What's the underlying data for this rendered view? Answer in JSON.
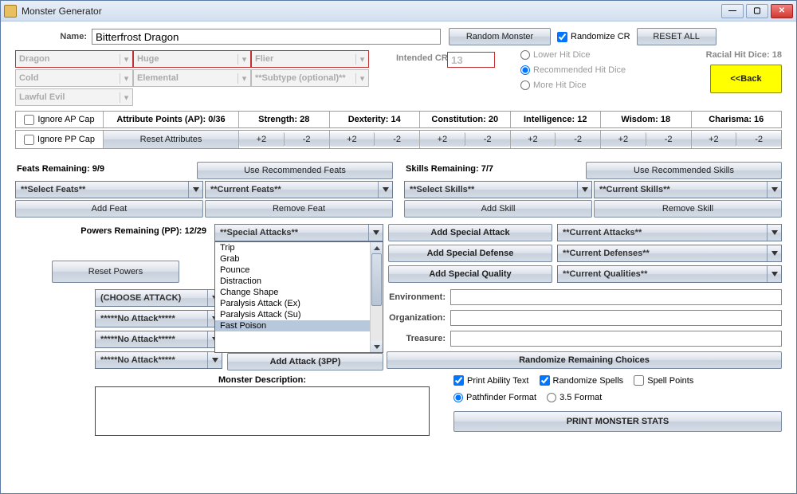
{
  "window_title": "Monster Generator",
  "name": {
    "label": "Name:",
    "value": "Bitterfrost Dragon"
  },
  "buttons": {
    "random_monster": "Random Monster",
    "randomize_cr": "Randomize CR",
    "reset_all": "RESET ALL",
    "back": "<<Back",
    "reset_attributes": "Reset Attributes",
    "use_rec_feats": "Use Recommended Feats",
    "use_rec_skills": "Use Recommended Skills",
    "add_feat": "Add Feat",
    "remove_feat": "Remove Feat",
    "add_skill": "Add Skill",
    "remove_skill": "Remove Skill",
    "reset_powers": "Reset Powers",
    "add_sp_atk": "Add Special Attack",
    "add_sp_def": "Add Special Defense",
    "add_sp_qual": "Add Special Quality",
    "add_attack_3pp": "Add Attack (3PP)",
    "randomize_remaining": "Randomize Remaining Choices",
    "print_stats": "PRINT MONSTER STATS"
  },
  "type_combos": {
    "c1": "Dragon",
    "c2": "Huge",
    "c3": "Flier",
    "c4": "Cold",
    "c5": "Elemental",
    "c6": "**Subtype (optional)**",
    "c7": "Lawful Evil"
  },
  "cr": {
    "label": "Intended CR:",
    "value": "13"
  },
  "hit_dice": {
    "lower": "Lower Hit Dice",
    "rec": "Recommended Hit Dice",
    "more": "More Hit Dice",
    "racial": "Racial Hit Dice: 18"
  },
  "caps": {
    "ap": "Ignore AP Cap",
    "pp": "Ignore PP Cap",
    "ap_label": "Attribute Points (AP): 0/36"
  },
  "stats": {
    "str": "Strength: 28",
    "dex": "Dexterity: 14",
    "con": "Constitution: 20",
    "int": "Intelligence: 12",
    "wis": "Wisdom: 18",
    "cha": "Charisma: 16",
    "plus": "+2",
    "minus": "-2"
  },
  "feats_remaining": "Feats Remaining: 9/9",
  "skills_remaining": "Skills Remaining: 7/7",
  "select_feats": "**Select Feats**",
  "current_feats": "**Current Feats**",
  "select_skills": "**Select Skills**",
  "current_skills": "**Current Skills**",
  "powers_remaining": "Powers Remaining (PP): 12/29",
  "special_attacks": "**Special Attacks**",
  "current_attacks": "**Current Attacks**",
  "current_defenses": "**Current Defenses**",
  "current_qualities": "**Current Qualities**",
  "sa_options": [
    "Trip",
    "Grab",
    "Pounce",
    "Distraction",
    "Change Shape",
    "Paralysis Attack (Ex)",
    "Paralysis Attack (Su)",
    "Fast Poison"
  ],
  "attack_choose": "(CHOOSE ATTACK)",
  "no_attack": "*****No Attack*****",
  "env": {
    "label1": "Environment:",
    "label2": "Organization:",
    "label3": "Treasure:"
  },
  "desc_label": "Monster Description:",
  "print_opts": {
    "ability_text": "Print Ability Text",
    "rand_spells": "Randomize Spells",
    "spell_points": "Spell Points",
    "pf": "Pathfinder Format",
    "f35": "3.5 Format"
  }
}
